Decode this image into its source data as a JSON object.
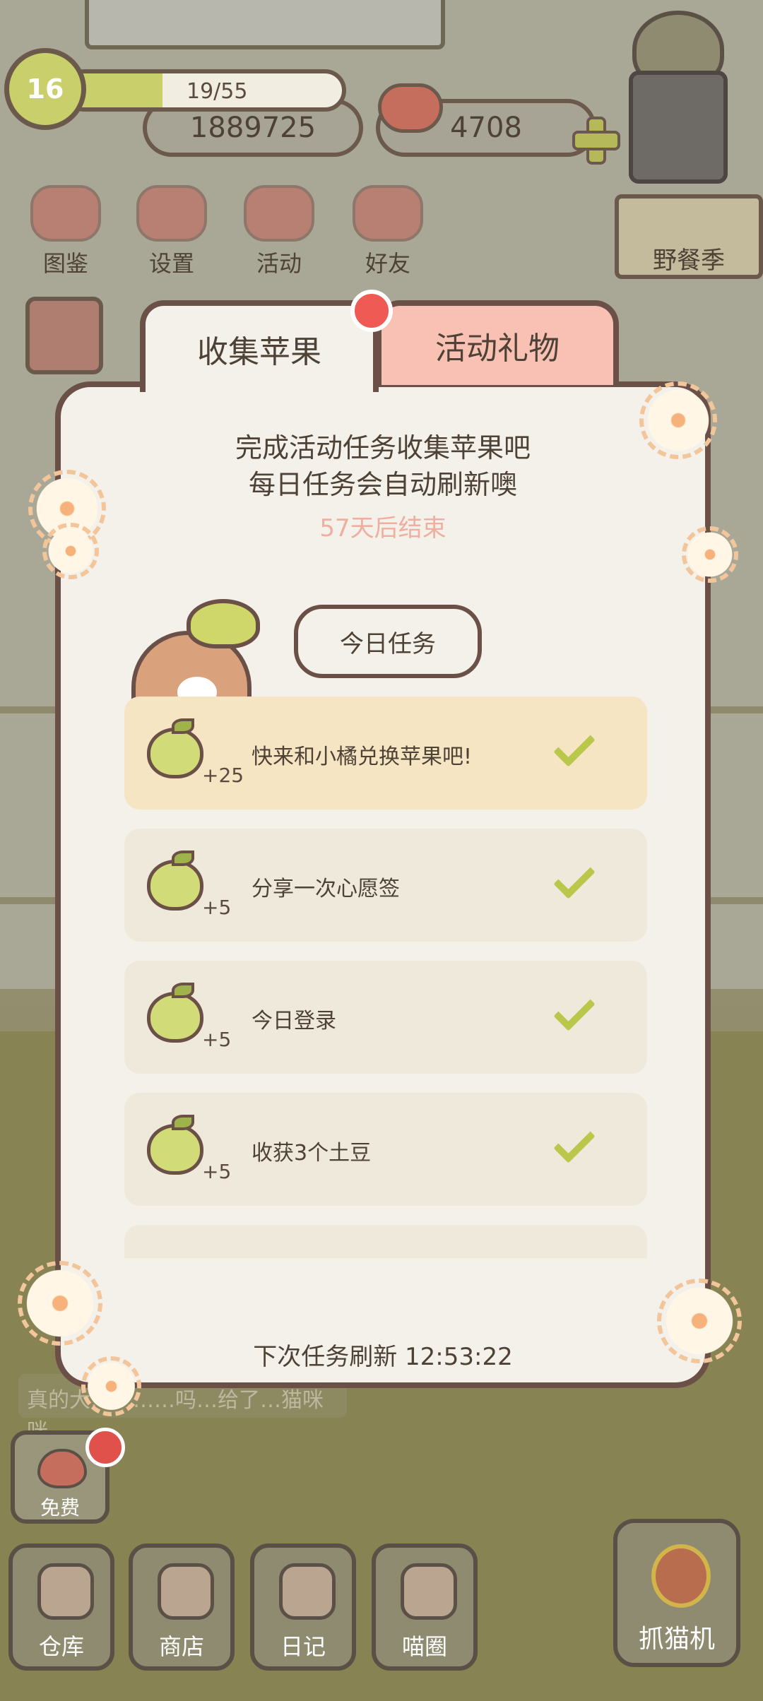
{
  "hud": {
    "level": "16",
    "xp_text": "19/55",
    "xp_progress": 0.345,
    "coins": "1889725",
    "hearts": "4708"
  },
  "menu": [
    {
      "label": "图鉴"
    },
    {
      "label": "设置"
    },
    {
      "label": "活动"
    },
    {
      "label": "好友"
    }
  ],
  "event_banner": {
    "label": "野餐季"
  },
  "modal": {
    "tabs": [
      {
        "label": "收集苹果",
        "active": true
      },
      {
        "label": "活动礼物",
        "active": false
      }
    ],
    "intro_line1": "完成活动任务收集苹果吧",
    "intro_line2": "每日任务会自动刷新噢",
    "countdown": "57天后结束",
    "section_title": "今日任务",
    "tasks": [
      {
        "reward": "+25",
        "label": "快来和小橘兑换苹果吧!",
        "done": true,
        "highlight": true
      },
      {
        "reward": "+5",
        "label": "分享一次心愿签",
        "done": true,
        "highlight": false
      },
      {
        "reward": "+5",
        "label": "今日登录",
        "done": true,
        "highlight": false
      },
      {
        "reward": "+5",
        "label": "收获3个土豆",
        "done": true,
        "highlight": false
      }
    ],
    "refresh_text": "下次任务刷新 12:53:22"
  },
  "chat_text": "真的大…………吗…给了…猫咪咪",
  "free_button": {
    "label": "免费"
  },
  "bottom_nav": [
    {
      "label": "仓库"
    },
    {
      "label": "商店"
    },
    {
      "label": "日记"
    },
    {
      "label": "喵圈"
    }
  ],
  "claw_machine": {
    "label": "抓猫机"
  },
  "colors": {
    "accent_green": "#c9cf6a",
    "modal_bg": "#f4f1ea",
    "gift_tab": "#f8c1b4",
    "countdown": "#f0aea0",
    "badge_red": "#ef5a54"
  }
}
